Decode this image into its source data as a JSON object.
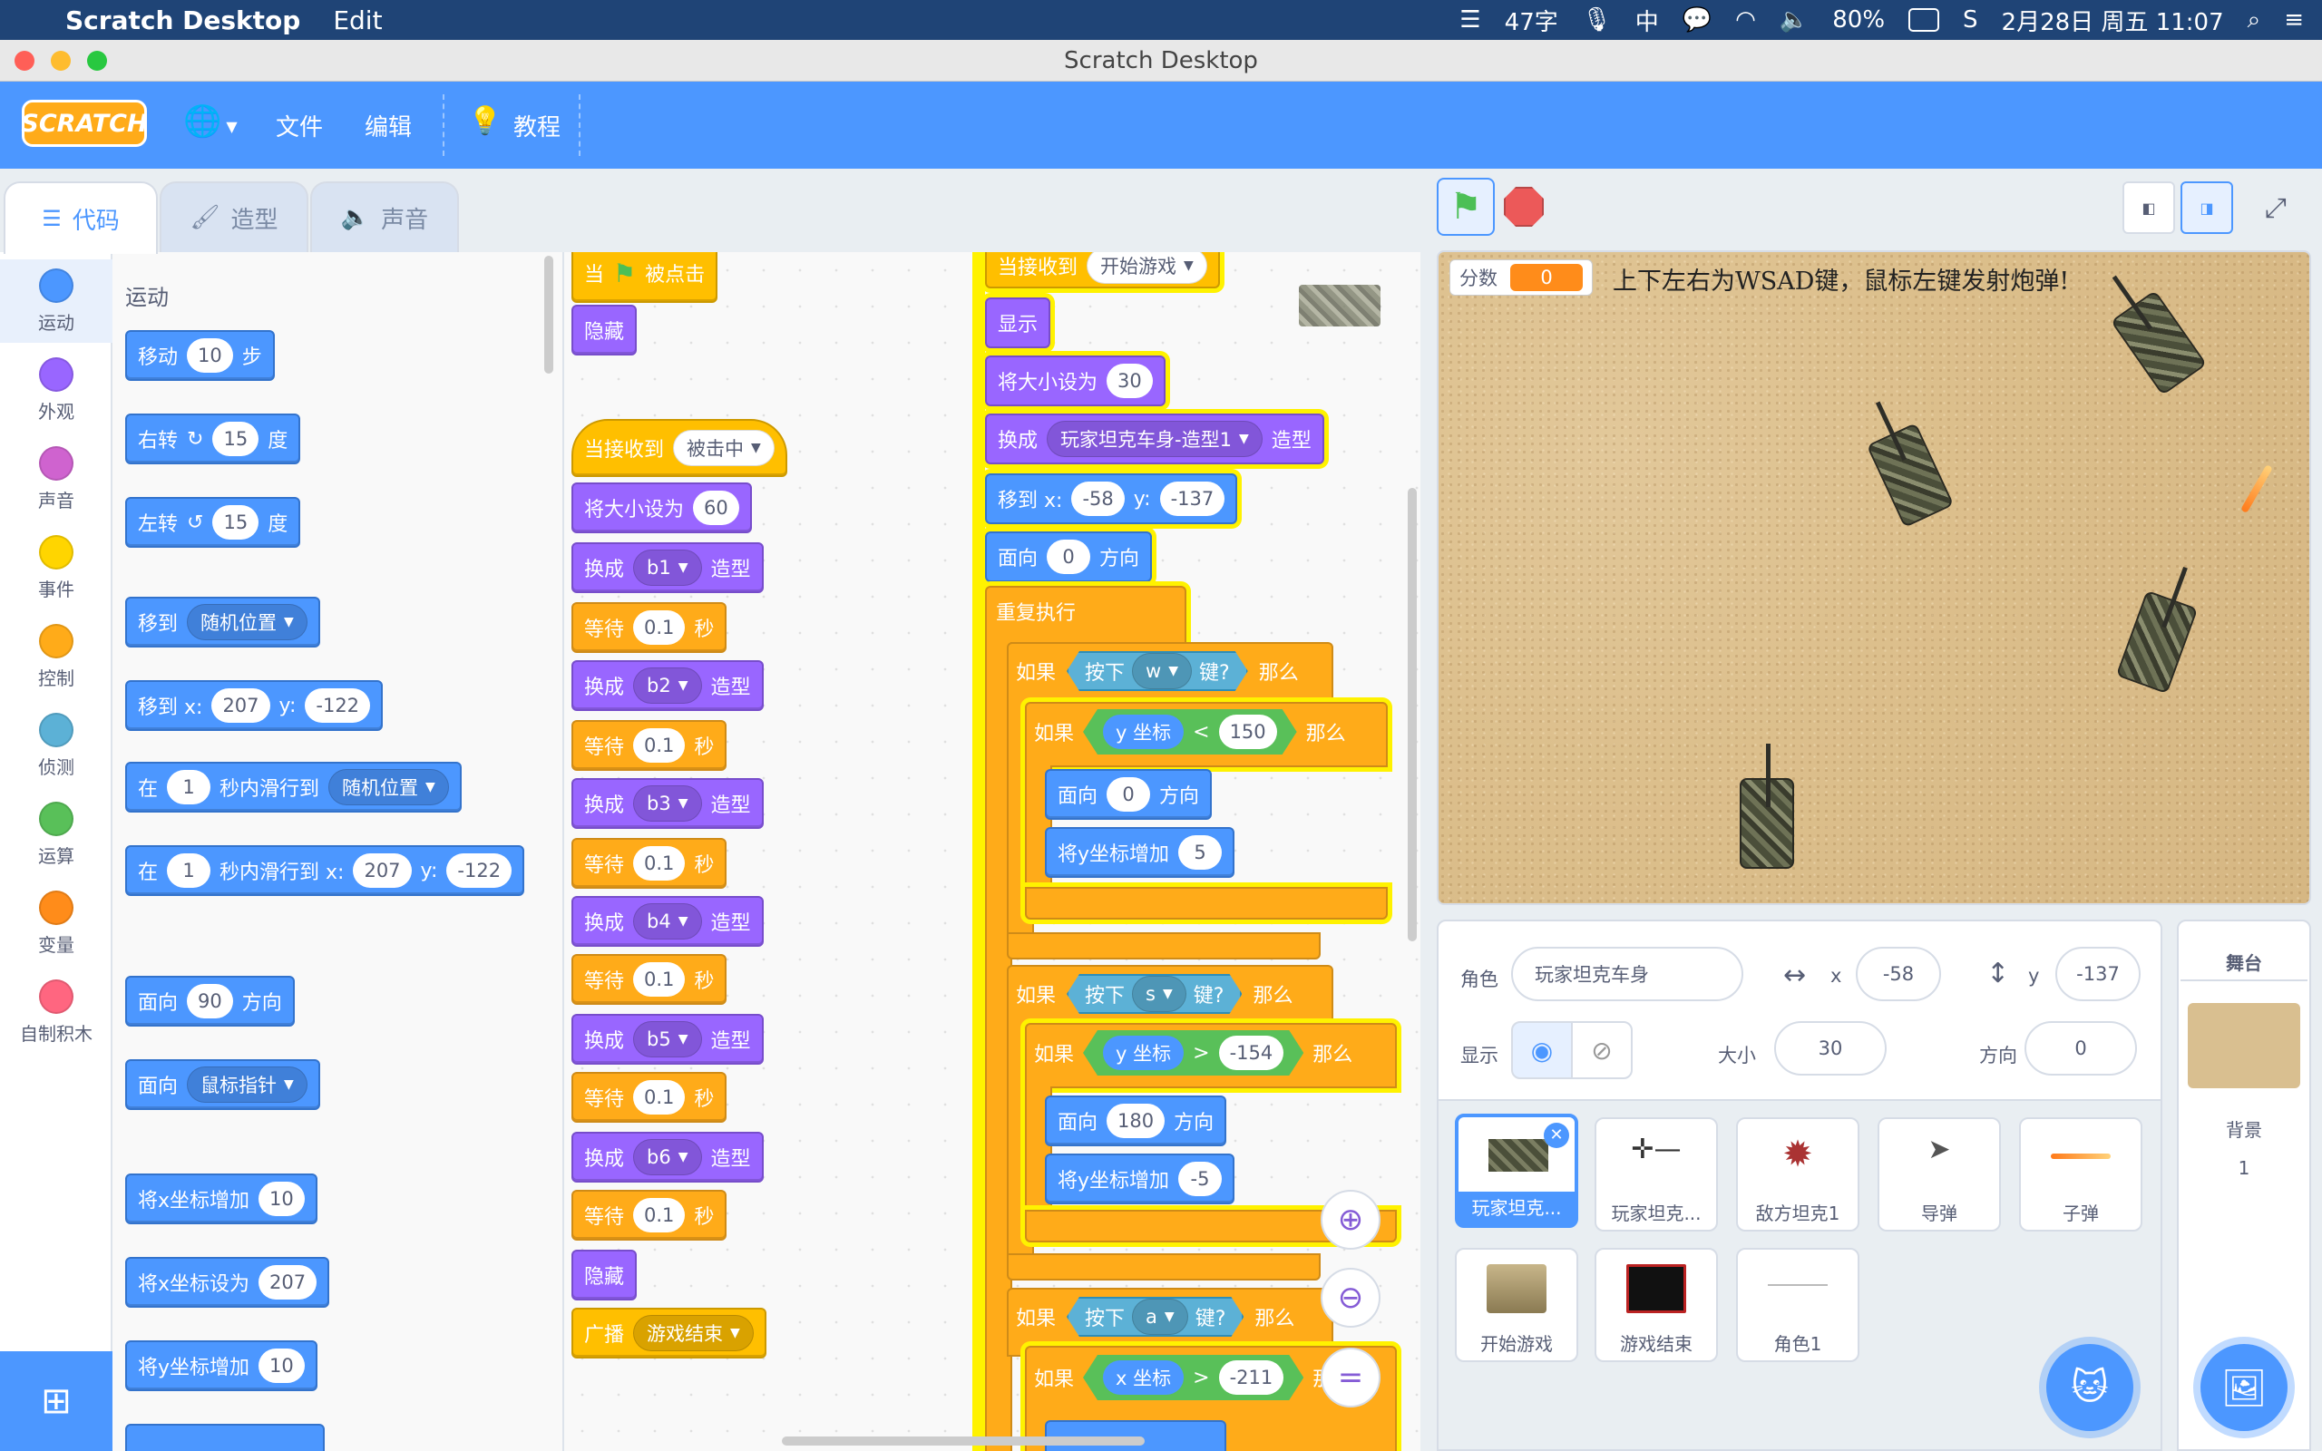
{
  "menubar": {
    "app_name": "Scratch Desktop",
    "edit": "Edit",
    "ime_count": "47字",
    "ime_mode": "中",
    "battery": "80%",
    "datetime": "2月28日 周五  11:07"
  },
  "window": {
    "title": "Scratch Desktop"
  },
  "scratch_menu": {
    "logo": "SCRATCH",
    "file": "文件",
    "edit": "编辑",
    "tutorials": "教程"
  },
  "tabs": {
    "code": "代码",
    "costumes": "造型",
    "sounds": "声音"
  },
  "categories": [
    {
      "label": "运动",
      "color": "#4c97ff"
    },
    {
      "label": "外观",
      "color": "#9966ff"
    },
    {
      "label": "声音",
      "color": "#cf63cf"
    },
    {
      "label": "事件",
      "color": "#ffd500"
    },
    {
      "label": "控制",
      "color": "#ffab19"
    },
    {
      "label": "侦测",
      "color": "#5cb1d6"
    },
    {
      "label": "运算",
      "color": "#59c059"
    },
    {
      "label": "变量",
      "color": "#ff8c1a"
    },
    {
      "label": "自制积木",
      "color": "#ff6680"
    }
  ],
  "palette": {
    "heading": "运动",
    "move": [
      "移动",
      "10",
      "步"
    ],
    "turn_right": [
      "右转",
      "15",
      "度"
    ],
    "turn_left": [
      "左转",
      "15",
      "度"
    ],
    "goto": [
      "移到",
      "随机位置"
    ],
    "goto_xy": [
      "移到 x:",
      "207",
      "y:",
      "-122"
    ],
    "glide": [
      "在",
      "1",
      "秒内滑行到",
      "随机位置"
    ],
    "glide_xy": [
      "在",
      "1",
      "秒内滑行到 x:",
      "207",
      "y:",
      "-122"
    ],
    "point_dir": [
      "面向",
      "90",
      "方向"
    ],
    "point_towards": [
      "面向",
      "鼠标指针"
    ],
    "change_x": [
      "将x坐标增加",
      "10"
    ],
    "set_x": [
      "将x坐标设为",
      "207"
    ],
    "change_y": [
      "将y坐标增加",
      "10"
    ]
  },
  "script1": {
    "hat": [
      "当",
      "被点击"
    ],
    "hide": "隐藏"
  },
  "script2": {
    "hat": [
      "当接收到",
      "被击中"
    ],
    "set_size": [
      "将大小设为",
      "60"
    ],
    "switch1": [
      "换成",
      "b1",
      "造型"
    ],
    "wait1": [
      "等待",
      "0.1",
      "秒"
    ],
    "switch2": [
      "换成",
      "b2",
      "造型"
    ],
    "wait2": [
      "等待",
      "0.1",
      "秒"
    ],
    "switch3": [
      "换成",
      "b3",
      "造型"
    ],
    "wait3": [
      "等待",
      "0.1",
      "秒"
    ],
    "switch4": [
      "换成",
      "b4",
      "造型"
    ],
    "wait4": [
      "等待",
      "0.1",
      "秒"
    ],
    "switch5": [
      "换成",
      "b5",
      "造型"
    ],
    "wait5": [
      "等待",
      "0.1",
      "秒"
    ],
    "switch6": [
      "换成",
      "b6",
      "造型"
    ],
    "wait6": [
      "等待",
      "0.1",
      "秒"
    ],
    "hide": "隐藏",
    "broadcast": [
      "广播",
      "游戏结束"
    ]
  },
  "script3": {
    "hat": [
      "当接收到",
      "开始游戏"
    ],
    "show": "显示",
    "set_size": [
      "将大小设为",
      "30"
    ],
    "switch": [
      "换成",
      "玩家坦克车身-造型1",
      "造型"
    ],
    "goto": [
      "移到 x:",
      "-58",
      "y:",
      "-137"
    ],
    "point": [
      "面向",
      "0",
      "方向"
    ],
    "forever": "重复执行",
    "if1": [
      "如果",
      "按下",
      "w",
      "键?",
      "那么"
    ],
    "if1a": [
      "如果",
      "y 坐标",
      "<",
      "150",
      "那么"
    ],
    "if1a_point": [
      "面向",
      "0",
      "方向"
    ],
    "if1a_change": [
      "将y坐标增加",
      "5"
    ],
    "if2": [
      "如果",
      "按下",
      "s",
      "键?",
      "那么"
    ],
    "if2a": [
      "如果",
      "y 坐标",
      ">",
      "-154",
      "那么"
    ],
    "if2a_point": [
      "面向",
      "180",
      "方向"
    ],
    "if2a_change": [
      "将y坐标增加",
      "-5"
    ],
    "if3": [
      "如果",
      "按下",
      "a",
      "键?",
      "那么"
    ],
    "if3a": [
      "如果",
      "x 坐标",
      ">",
      "-211",
      "那么"
    ]
  },
  "stage": {
    "monitor_label": "分数",
    "monitor_value": "0",
    "hint": "上下左右为WSAD键，鼠标左键发射炮弹!"
  },
  "sprite_info": {
    "sprite_label": "角色",
    "sprite_name": "玩家坦克车身",
    "x_label": "x",
    "x": "-58",
    "y_label": "y",
    "y": "-137",
    "show_label": "显示",
    "size_label": "大小",
    "size": "30",
    "direction_label": "方向",
    "direction": "0"
  },
  "sprites": [
    "玩家坦克...",
    "玩家坦克...",
    "敌方坦克1",
    "导弹",
    "子弹",
    "开始游戏",
    "游戏结束",
    "角色1"
  ],
  "stage_panel": {
    "title": "舞台",
    "backdrop_label": "背景",
    "backdrop_count": "1"
  }
}
